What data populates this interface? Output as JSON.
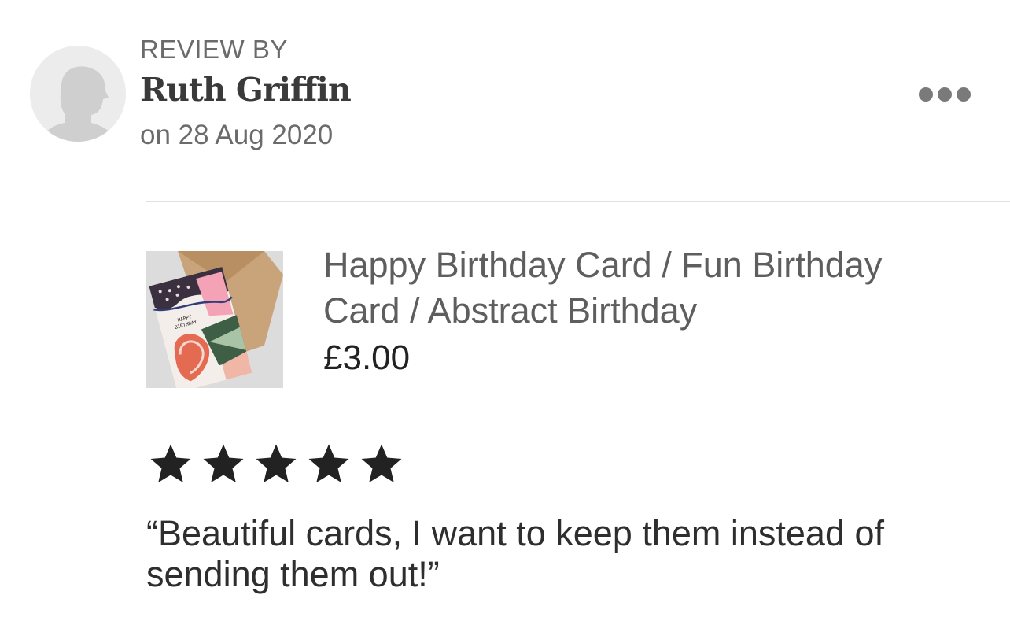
{
  "review": {
    "heading": "REVIEW BY",
    "reviewer_name": "Ruth Griffin",
    "date": "on 28 Aug 2020",
    "rating_value": 5,
    "rating_max": 5,
    "text": "“Beautiful cards, I want to keep them instead of sending them out!”"
  },
  "product": {
    "title": "Happy Birthday Card / Fun Birthday Card / Abstract Birthday",
    "price": "£3.00",
    "image_text_line1": "HAPPY",
    "image_text_line2": "BIRTHDAY"
  },
  "icons": {
    "avatar": "user-silhouette-icon",
    "more": "more-dots-icon",
    "star": "star-icon"
  },
  "colors": {
    "secondary_text": "#6b6b6b",
    "star": "#222222",
    "divider": "#e1e1e1"
  }
}
